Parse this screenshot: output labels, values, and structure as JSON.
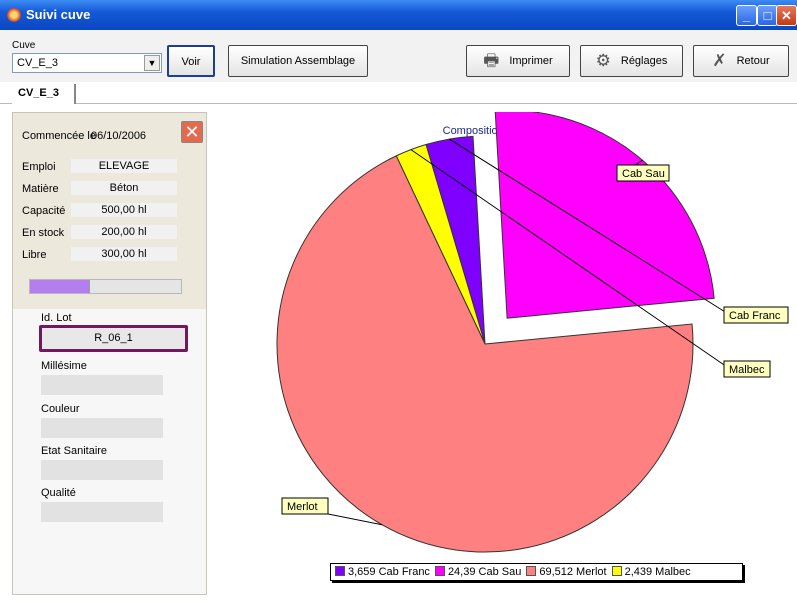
{
  "window": {
    "title": "Suivi cuve"
  },
  "toolbar": {
    "cuve_label": "Cuve",
    "cuve_value": "CV_E_3",
    "voir": "Voir",
    "simulation": "Simulation Assemblage",
    "imprimer": "Imprimer",
    "reglages": "Réglages",
    "retour": "Retour"
  },
  "tab": {
    "label": "CV_E_3"
  },
  "panel": {
    "started_label": "Commencée le",
    "started_date": "06/10/2006",
    "rows": [
      {
        "label": "Emploi",
        "value": "ELEVAGE"
      },
      {
        "label": "Matière",
        "value": "Béton"
      },
      {
        "label": "Capacité",
        "value": "500,00 hl"
      },
      {
        "label": "En stock",
        "value": "200,00 hl"
      },
      {
        "label": "Libre",
        "value": "300,00 hl"
      }
    ],
    "fill_fraction": 0.4,
    "lot_label": "Id. Lot",
    "lot_value": "R_06_1",
    "fields": [
      "Millésime",
      "Couleur",
      "Etat Sanitaire",
      "Qualité"
    ]
  },
  "chart_data": {
    "type": "pie",
    "title": "Composition de cuve",
    "slices": [
      {
        "name": "Cab Sau",
        "value": 24.39,
        "color": "#ff00ff",
        "legend": "24,39 Cab Sau",
        "exploded": true
      },
      {
        "name": "Cab Franc",
        "value": 3.659,
        "color": "#7f00ff",
        "legend": "3,659 Cab Franc",
        "exploded": false
      },
      {
        "name": "Malbec",
        "value": 2.439,
        "color": "#ffff00",
        "legend": "2,439 Malbec",
        "exploded": false
      },
      {
        "name": "Merlot",
        "value": 69.512,
        "color": "#ff8080",
        "legend": "69,512 Merlot",
        "exploded": false
      }
    ],
    "legend_order": [
      "Cab Franc",
      "Cab Sau",
      "Merlot",
      "Malbec"
    ],
    "legend_placement": "bottom"
  }
}
